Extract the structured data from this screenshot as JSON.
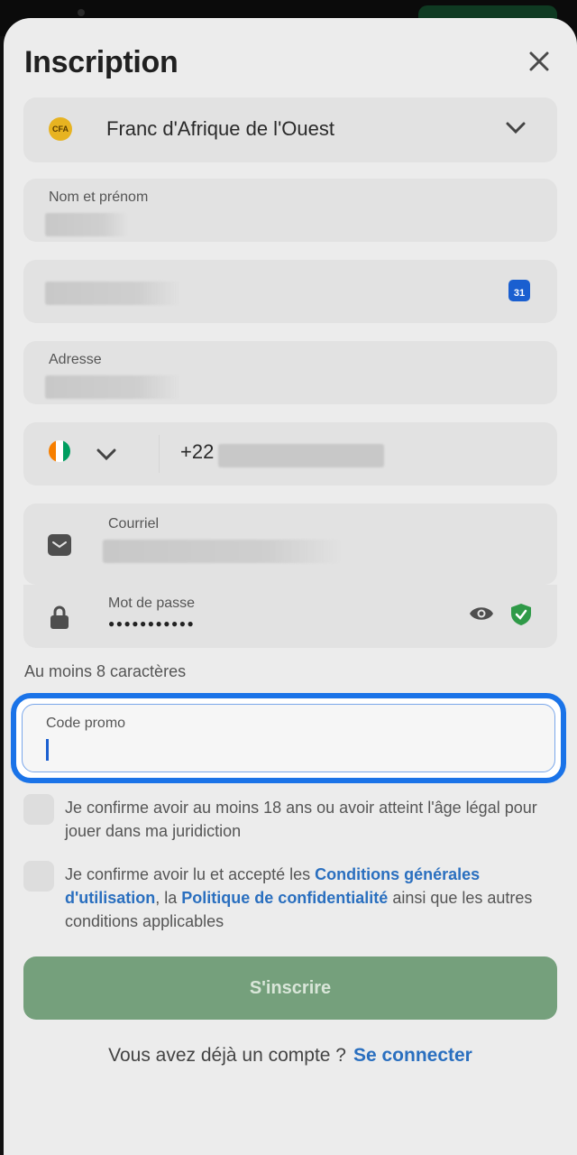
{
  "sheet": {
    "title": "Inscription"
  },
  "currency": {
    "badge": "CFA",
    "label": "Franc d'Afrique de l'Ouest"
  },
  "fields": {
    "full_name_label": "Nom et prénom",
    "address_label": "Adresse",
    "phone_prefix": "+22",
    "email_label": "Courriel",
    "password_label": "Mot de passe",
    "password_mask": "●●●●●●●●●●●",
    "calendar_day": "31"
  },
  "password_hint": "Au moins 8 caractères",
  "promo": {
    "label": "Code promo"
  },
  "consents": {
    "age": "Je confirme avoir au moins 18 ans ou avoir atteint l'âge légal pour jouer dans ma juridiction",
    "terms_prefix": "Je confirme avoir lu et accepté les ",
    "terms_link": "Conditions générales d'utilisation",
    "terms_mid": ", la ",
    "privacy_link": "Politique de confidentialité",
    "terms_suffix": " ainsi que les autres conditions applicables"
  },
  "submit_label": "S'inscrire",
  "footer": {
    "question": "Vous avez déjà un compte ?",
    "login_link": "Se connecter"
  },
  "colors": {
    "accent": "#1a73e8",
    "link": "#2a6fbf",
    "submit": "#75a07c",
    "shield": "#2f9a48"
  }
}
